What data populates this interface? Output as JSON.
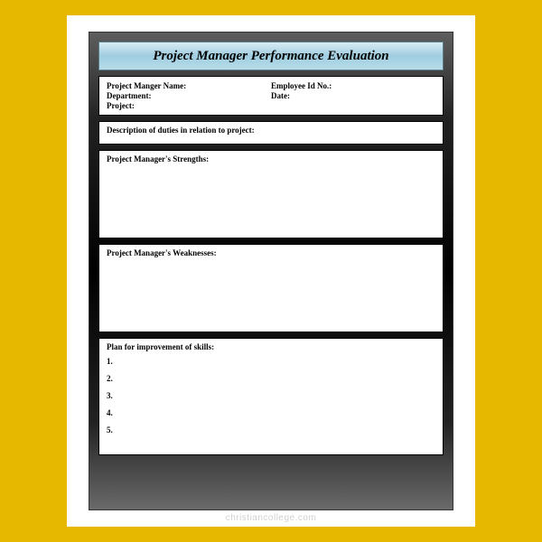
{
  "title": "Project Manager Performance Evaluation",
  "info": {
    "name_label": "Project Manger Name:",
    "department_label": "Department:",
    "project_label": "Project:",
    "employee_id_label": "Employee Id No.:",
    "date_label": "Date:"
  },
  "sections": {
    "description": "Description of duties in relation to project:",
    "strengths": "Project Manager's Strengths:",
    "weaknesses": "Project Manager's Weaknesses:",
    "improvement_title": "Plan for improvement of skills:",
    "improvement_items": [
      "1.",
      "2.",
      "3.",
      "4.",
      "5."
    ]
  },
  "watermark": "christiancollege.com"
}
